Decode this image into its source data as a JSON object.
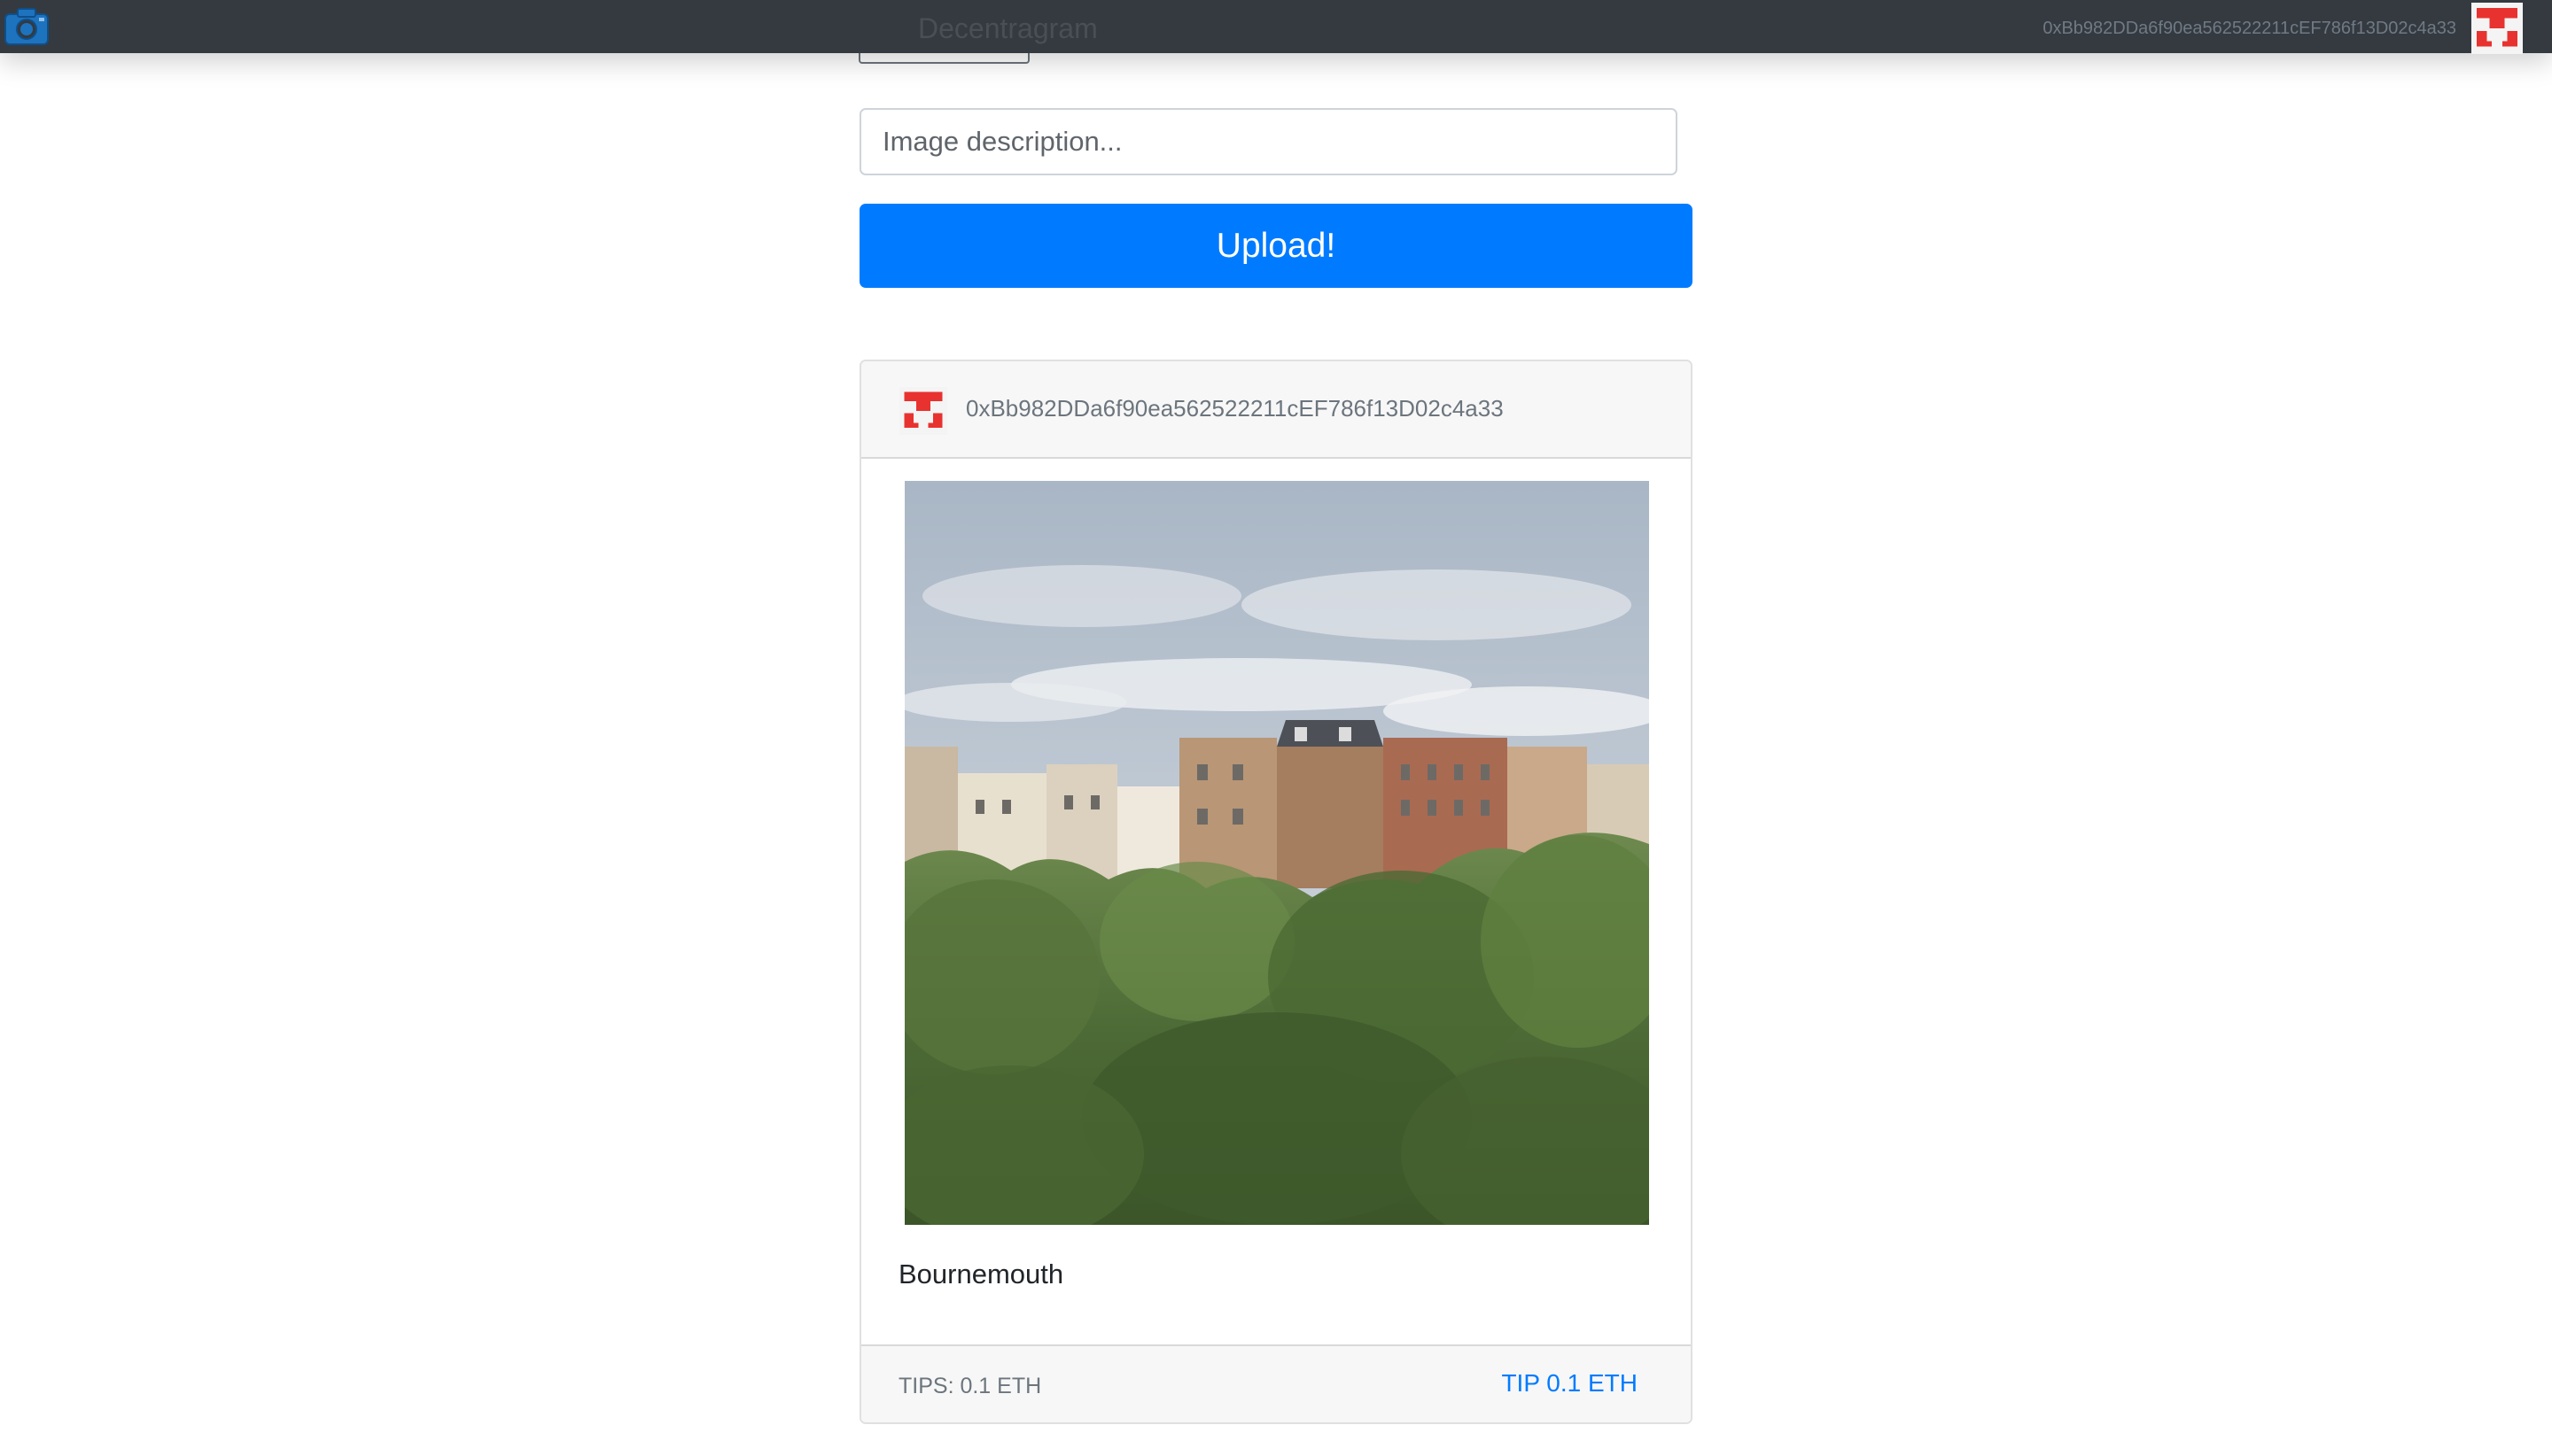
{
  "app": {
    "title": "Decentragram",
    "brand_icon": "camera-icon"
  },
  "navbar": {
    "account_address": "0xBb982DDa6f90ea562522211cEF786f13D02c4a33",
    "avatar": "identicon-avatar"
  },
  "upload_form": {
    "description_placeholder": "Image description...",
    "description_value": "",
    "upload_label": "Upload!"
  },
  "posts": [
    {
      "author": "0xBb982DDa6f90ea562522211cEF786f13D02c4a33",
      "description": "Bournemouth",
      "tips": "TIPS: 0.1 ETH",
      "tip_action": "TIP 0.1 ETH"
    }
  ],
  "colors": {
    "navbar": "#343a40",
    "primary": "#007bff",
    "identicon": "#e8322f",
    "brand_icon": "#1e73be"
  }
}
